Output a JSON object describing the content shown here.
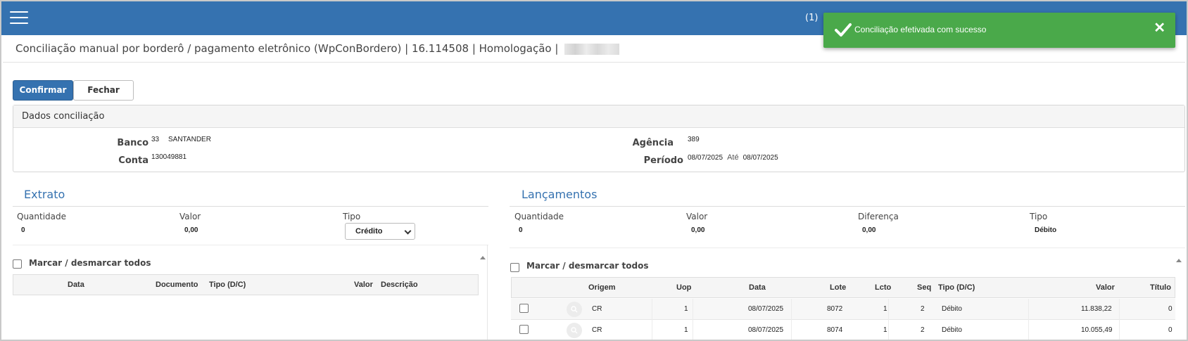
{
  "header": {
    "user_badge": "(1)",
    "menu_icon": "hamburger-icon"
  },
  "toast": {
    "message": "Conciliação efetivada com sucesso",
    "close": "✕",
    "color": "#4aa94a",
    "icon": "check-icon"
  },
  "page": {
    "title": "Conciliação manual por borderô / pagamento eletrônico (WpConBordero) | 16.114508 | Homologação |"
  },
  "toolbar": {
    "confirm_label": "Confirmar",
    "close_label": "Fechar",
    "accent": "#3572b0"
  },
  "dados": {
    "heading": "Dados conciliação",
    "banco_label": "Banco",
    "banco_code": "33",
    "banco_name": "SANTANDER",
    "conta_label": "Conta",
    "conta_value": "130049881",
    "agencia_label": "Agência",
    "agencia_value": "389",
    "periodo_label": "Período",
    "periodo_from": "08/07/2025",
    "periodo_ate": "Até",
    "periodo_to": "08/07/2025"
  },
  "extrato": {
    "title": "Extrato",
    "quantidade_label": "Quantidade",
    "quantidade_value": "0",
    "valor_label": "Valor",
    "valor_value": "0,00",
    "tipo_label": "Tipo",
    "tipo_selected": "Crédito",
    "mark_all_label": "Marcar / desmarcar todos",
    "columns": [
      "Data",
      "Documento",
      "Tipo (D/C)",
      "Valor",
      "Descrição"
    ]
  },
  "lancamentos": {
    "title": "Lançamentos",
    "quantidade_label": "Quantidade",
    "quantidade_value": "0",
    "valor_label": "Valor",
    "valor_value": "0,00",
    "diferenca_label": "Diferença",
    "diferenca_value": "0,00",
    "tipo_label": "Tipo",
    "tipo_value": "Débito",
    "mark_all_label": "Marcar / desmarcar todos",
    "columns": [
      "Origem",
      "Uop",
      "Data",
      "Lote",
      "Lcto",
      "Seq",
      "Tipo (D/C)",
      "Valor",
      "Título"
    ],
    "rows": [
      {
        "origem": "CR",
        "uop": "1",
        "data": "08/07/2025",
        "lote": "8072",
        "lcto": "1",
        "seq": "2",
        "tipo": "Débito",
        "valor": "11.838,22",
        "titulo": "0"
      },
      {
        "origem": "CR",
        "uop": "1",
        "data": "08/07/2025",
        "lote": "8074",
        "lcto": "1",
        "seq": "2",
        "tipo": "Débito",
        "valor": "10.055,49",
        "titulo": "0"
      }
    ]
  }
}
